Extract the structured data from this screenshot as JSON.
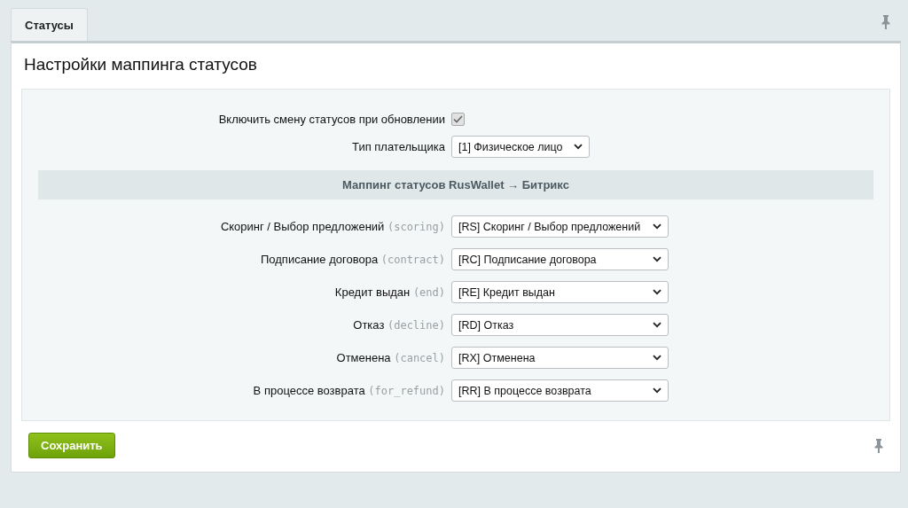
{
  "tabs": [
    {
      "label": "Статусы",
      "selected": true
    }
  ],
  "title": "Настройки маппинга статусов",
  "settings": {
    "enable_label": "Включить смену статусов при обновлении",
    "enable_checked": true,
    "payer_label": "Тип плательщика",
    "payer_value": "[1] Физическое лицо"
  },
  "section_title": "Маппинг статусов RusWallet → Битрикс",
  "mappings": [
    {
      "label": "Скоринг / Выбор предложений",
      "code": "(scoring)",
      "value": "[RS] Скоринг / Выбор предложений"
    },
    {
      "label": "Подписание договора",
      "code": "(contract)",
      "value": "[RC] Подписание договора"
    },
    {
      "label": "Кредит выдан",
      "code": "(end)",
      "value": "[RE] Кредит выдан"
    },
    {
      "label": "Отказ",
      "code": "(decline)",
      "value": "[RD] Отказ"
    },
    {
      "label": "Отменена",
      "code": "(cancel)",
      "value": "[RX] Отменена"
    },
    {
      "label": "В процессе возврата",
      "code": "(for_refund)",
      "value": "[RR] В процессе возврата"
    }
  ],
  "save_button": "Сохранить"
}
